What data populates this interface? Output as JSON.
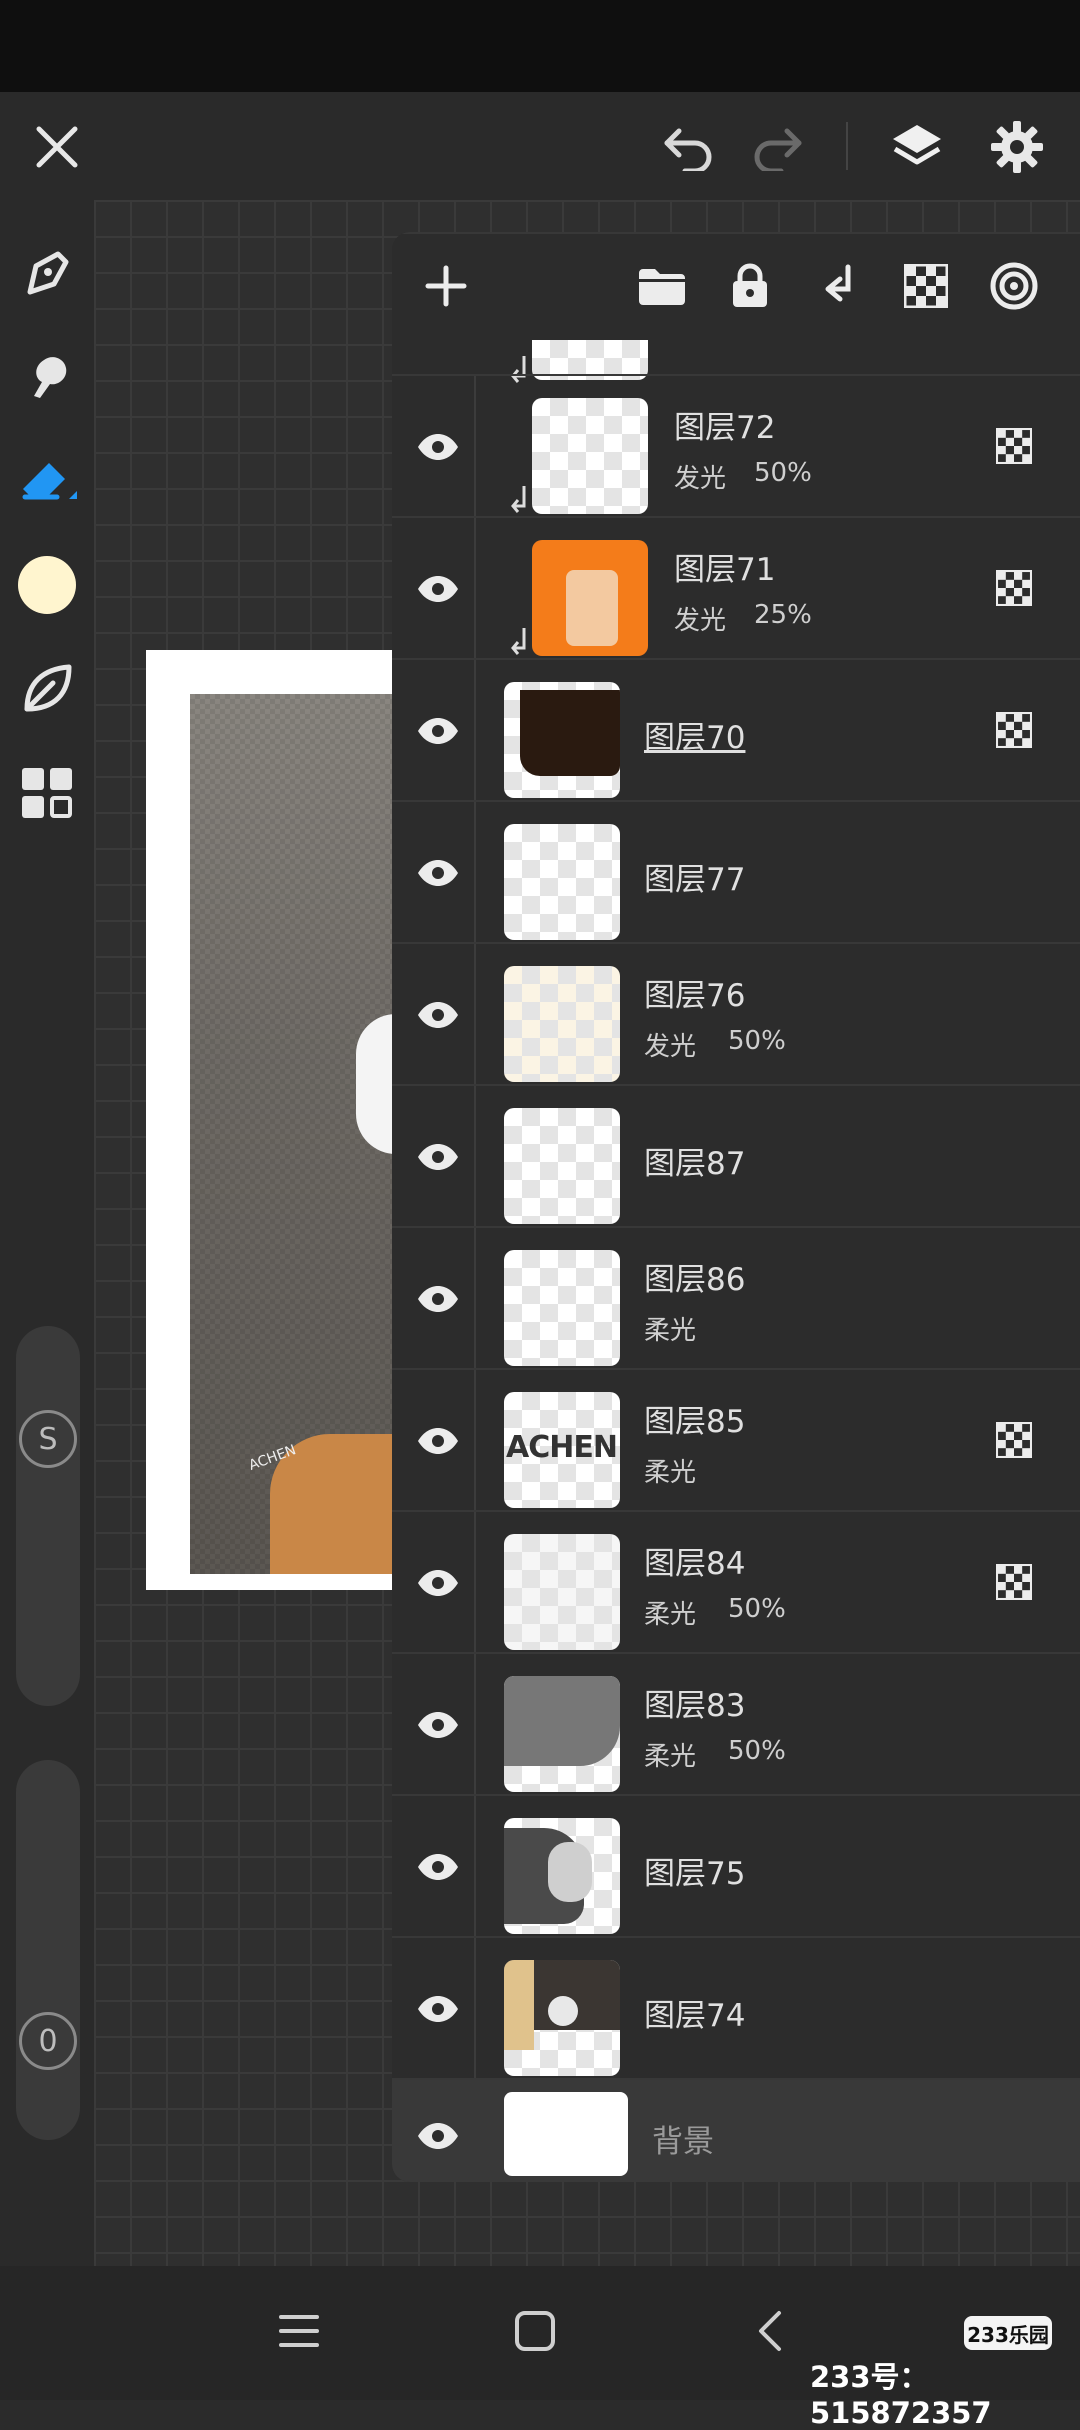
{
  "colors": {
    "accent": "#2196f3",
    "current_color": "#fff5cf",
    "panel_bg": "#2c2c2c",
    "background_row": "#393939"
  },
  "toolbar": {
    "tools": [
      "brush-tool-icon",
      "smudge-tool-icon",
      "eraser-tool-icon",
      "color-swatch",
      "leaf-tool-icon",
      "gallery-grid-icon"
    ],
    "size_slider_label": "S",
    "opacity_slider_label": "0"
  },
  "layers_panel": {
    "icons": [
      "add-layer-icon",
      "folder-icon",
      "lock-icon",
      "merge-down-icon",
      "checker-icon",
      "target-icon"
    ],
    "layers": [
      {
        "name": "图层72",
        "mode": "发光",
        "opacity": "50%"
      },
      {
        "name": "图层71",
        "mode": "发光",
        "opacity": "25%"
      },
      {
        "name": "图层70",
        "mode": "",
        "opacity": ""
      },
      {
        "name": "图层77",
        "mode": "",
        "opacity": ""
      },
      {
        "name": "图层76",
        "mode": "发光",
        "opacity": "50%"
      },
      {
        "name": "图层87",
        "mode": "",
        "opacity": ""
      },
      {
        "name": "图层86",
        "mode": "柔光",
        "opacity": ""
      },
      {
        "name": "图层85",
        "mode": "柔光",
        "opacity": ""
      },
      {
        "name": "图层84",
        "mode": "柔光",
        "opacity": "50%"
      },
      {
        "name": "图层83",
        "mode": "柔光",
        "opacity": "50%"
      },
      {
        "name": "图层75",
        "mode": "",
        "opacity": ""
      },
      {
        "name": "图层74",
        "mode": "",
        "opacity": ""
      }
    ],
    "background_label": "背景",
    "thumb_text_85": "ACHEN"
  },
  "artwork": {
    "caption": "ACHEN"
  },
  "watermark": {
    "badge": "233乐园",
    "id": "233号：515872357"
  }
}
